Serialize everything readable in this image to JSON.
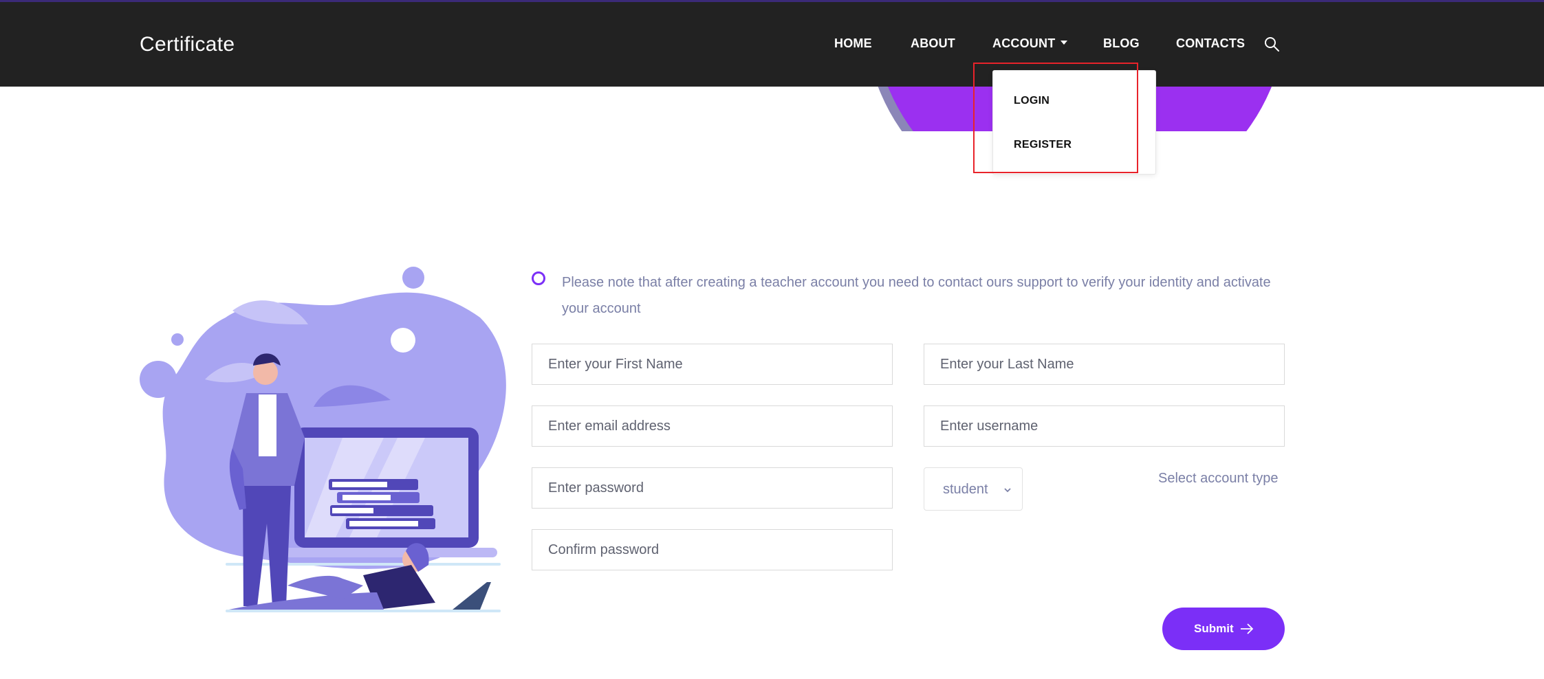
{
  "brand": "Certificate",
  "nav": {
    "home": "HOME",
    "about": "ABOUT",
    "account": "ACCOUNT",
    "blog": "BLOG",
    "contacts": "CONTACTS"
  },
  "account_menu": {
    "login": "LOGIN",
    "register": "REGISTER"
  },
  "notice": "Please note that after creating a teacher account you need to contact ours support to verify your identity and activate your account",
  "form": {
    "first_name_placeholder": "Enter your First Name",
    "last_name_placeholder": "Enter your Last Name",
    "email_placeholder": "Enter email address",
    "username_placeholder": "Enter username",
    "password_placeholder": "Enter password",
    "confirm_password_placeholder": "Confirm password",
    "account_type_value": "student",
    "account_type_label": "Select account type",
    "submit_label": "Submit"
  },
  "colors": {
    "header_bg": "#222222",
    "accent": "#7b2ff7",
    "muted_text": "#7a7fa6",
    "highlight_border": "#e8232a"
  },
  "icons": {
    "search": "search-icon",
    "caret": "caret-down-icon",
    "select_chevron": "chevron-down-icon",
    "submit_arrow": "arrow-right-icon"
  }
}
